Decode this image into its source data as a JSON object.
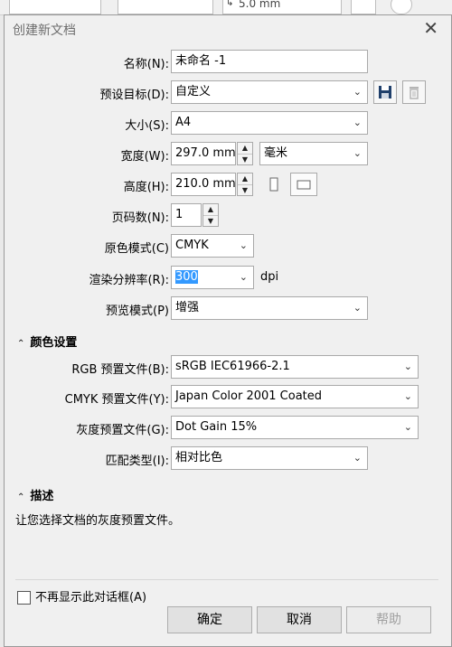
{
  "background": {
    "unit_value": "5.0 mm"
  },
  "dialog": {
    "title": "创建新文档",
    "close_glyph": "✕"
  },
  "form": {
    "name": {
      "label": "名称(N):",
      "value": "未命名 -1"
    },
    "preset": {
      "label": "预设目标(D):",
      "value": "自定义"
    },
    "size": {
      "label": "大小(S):",
      "value": "A4"
    },
    "width": {
      "label": "宽度(W):",
      "value": "297.0 mm",
      "unit": "毫米"
    },
    "height": {
      "label": "高度(H):",
      "value": "210.0 mm"
    },
    "pages": {
      "label": "页码数(N):",
      "value": "1"
    },
    "color_mode": {
      "label": "原色模式(C)",
      "value": "CMYK"
    },
    "render_res": {
      "label": "渲染分辨率(R):",
      "value": "300",
      "unit": "dpi"
    },
    "preview_mode": {
      "label": "预览模式(P)",
      "value": "增强"
    }
  },
  "color_settings": {
    "heading": "颜色设置",
    "rgb": {
      "label": "RGB 预置文件(B):",
      "value": "sRGB IEC61966-2.1"
    },
    "cmyk": {
      "label": "CMYK 预置文件(Y):",
      "value": "Japan Color 2001 Coated"
    },
    "gray": {
      "label": "灰度预置文件(G):",
      "value": "Dot Gain 15%"
    },
    "match": {
      "label": "匹配类型(I):",
      "value": "相对比色"
    }
  },
  "description": {
    "heading": "描述",
    "text": "让您选择文档的灰度预置文件。"
  },
  "footer": {
    "dont_show": "不再显示此对话框(A)",
    "ok": "确定",
    "cancel": "取消",
    "help": "帮助"
  },
  "icons": {
    "save": "save-icon",
    "delete": "trash-icon",
    "portrait": "portrait-icon",
    "landscape": "landscape-icon"
  },
  "colors": {
    "selection": "#3399ff",
    "save_icon": "#1f3f6b"
  }
}
